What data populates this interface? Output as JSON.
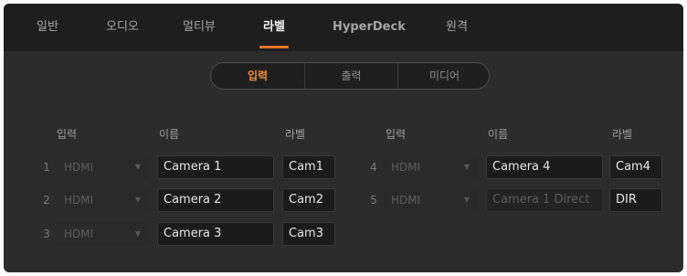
{
  "tabs": [
    {
      "label": "일반",
      "active": false
    },
    {
      "label": "오디오",
      "active": false
    },
    {
      "label": "멀티뷰",
      "active": false
    },
    {
      "label": "라벨",
      "active": true
    },
    {
      "label": "HyperDeck",
      "active": false
    },
    {
      "label": "원격",
      "active": false
    }
  ],
  "segments": [
    {
      "label": "입력",
      "active": true
    },
    {
      "label": "출력",
      "active": false
    },
    {
      "label": "미디어",
      "active": false
    }
  ],
  "columns": {
    "input": "입력",
    "name": "이름",
    "label": "라벨"
  },
  "rows": [
    {
      "number": "1",
      "source": "HDMI",
      "name": "Camera 1",
      "label": "Cam1"
    },
    {
      "number": "2",
      "source": "HDMI",
      "name": "Camera 2",
      "label": "Cam2"
    },
    {
      "number": "3",
      "source": "HDMI",
      "name": "Camera 3",
      "label": "Cam3"
    },
    {
      "number": "4",
      "source": "HDMI",
      "name": "Camera 4",
      "label": "Cam4"
    },
    {
      "number": "5",
      "source": "HDMI",
      "name_placeholder": "Camera 1 Direct",
      "label": "DIR"
    }
  ],
  "icons": {
    "dropdown": "chevron-down-icon"
  },
  "colors": {
    "accent": "#e8742b",
    "background": "#2c2c2c",
    "tabbar": "#1e1e1e"
  }
}
